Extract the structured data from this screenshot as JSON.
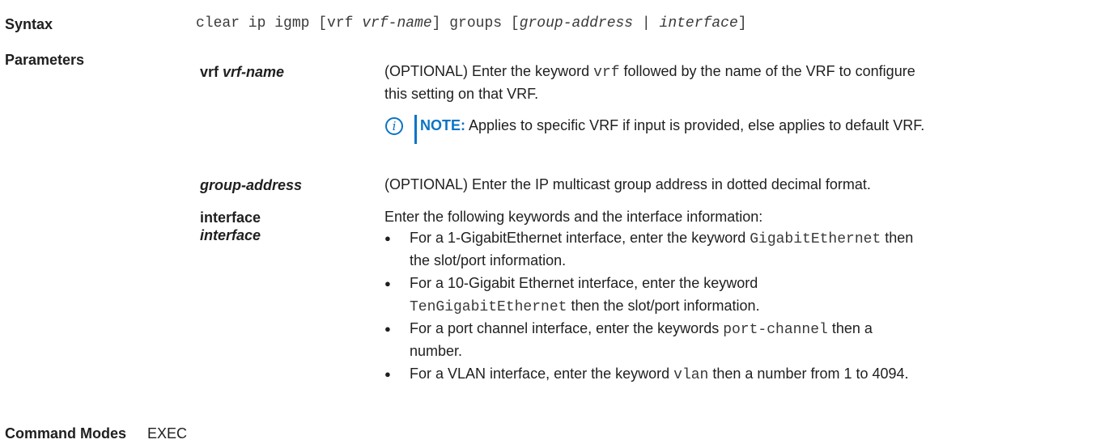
{
  "syntax": {
    "label": "Syntax",
    "cmd1": "clear ip igmp [vrf ",
    "arg1": "vrf-name",
    "cmd2": "] groups [",
    "arg2": "group-address",
    "cmd3": " | ",
    "arg3": "interface",
    "cmd4": "]"
  },
  "parameters": {
    "label": "Parameters",
    "vrf": {
      "name_kw": "vrf",
      "name_arg": "vrf-name",
      "line1_a": "(OPTIONAL) Enter the keyword ",
      "line1_code": "vrf",
      "line1_b": " followed by the name of the VRF to configure",
      "line2": "this setting on that VRF.",
      "note_icon": "info-icon",
      "note_label": "NOTE:",
      "note_text": " Applies to specific VRF if input is provided, else applies to default VRF."
    },
    "group": {
      "name": "group-address",
      "text": "(OPTIONAL) Enter the IP multicast group address in dotted decimal format."
    },
    "interface": {
      "name_kw": "interface",
      "name_arg": "interface",
      "intro": "Enter the following keywords and the interface information:",
      "b1_a": "For a 1-GigabitEthernet interface, enter the keyword ",
      "b1_code": "GigabitEthernet",
      "b1_b": " then",
      "b1_c": "the slot/port information.",
      "b2_a": "For a 10-Gigabit Ethernet interface, enter the keyword",
      "b2_code": "TenGigabitEthernet",
      "b2_b": " then the slot/port information.",
      "b3_a": "For a port channel interface, enter the keywords ",
      "b3_code": "port-channel",
      "b3_b": " then a",
      "b3_c": "number.",
      "b4_a": "For a VLAN interface, enter the keyword ",
      "b4_code": "vlan",
      "b4_b": " then a number from 1 to 4094."
    }
  },
  "command_modes": {
    "label": "Command Modes",
    "value": "EXEC"
  },
  "bullet_glyph": "●"
}
